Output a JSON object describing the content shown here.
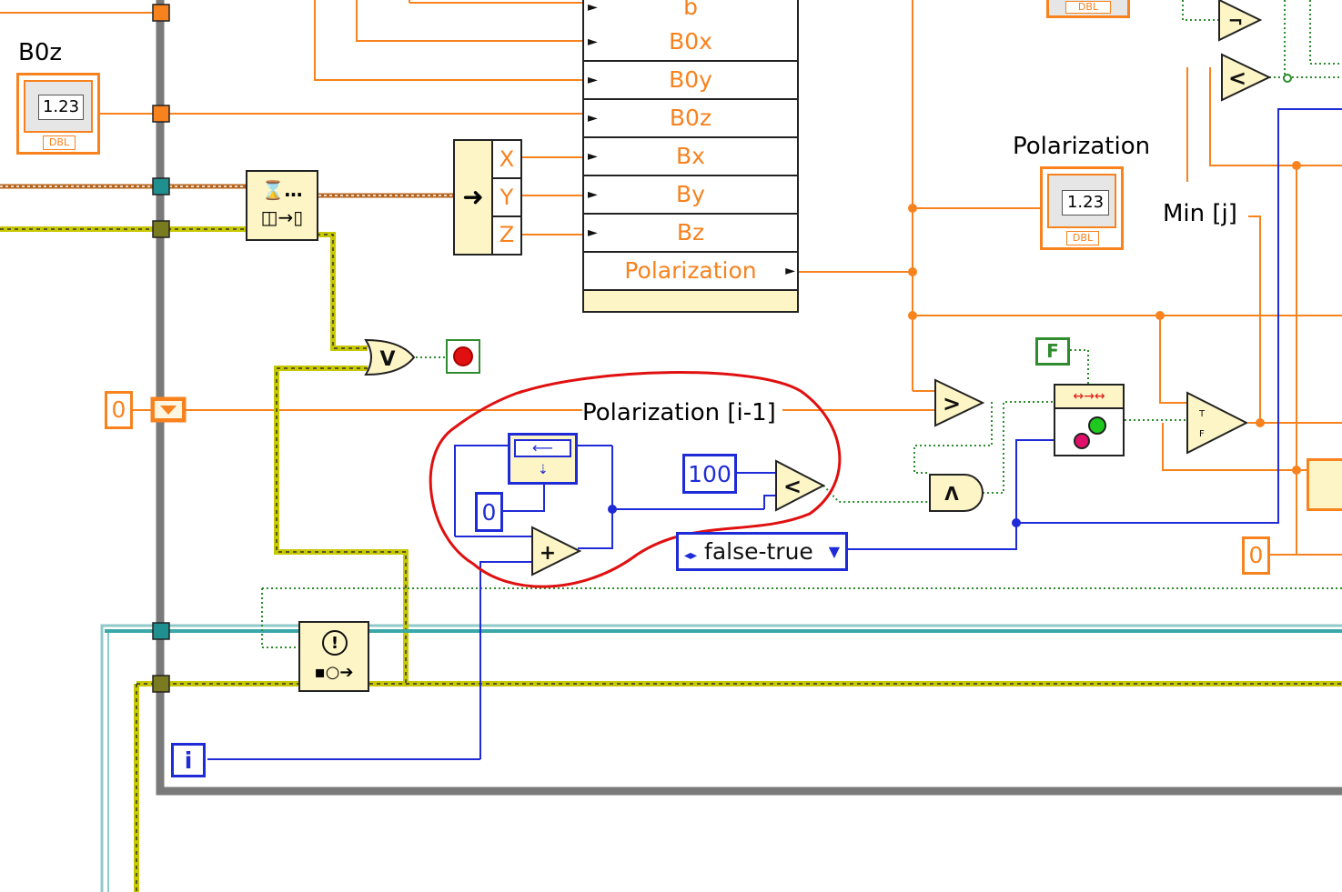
{
  "labels": {
    "b0z_label": "B0z",
    "polarization_label": "Polarization",
    "min_j_label": "Min [j]",
    "shift_register_label": "Polarization [i-1]"
  },
  "indicators": {
    "numeric_text": "1.23",
    "dbl_tag": "DBL"
  },
  "cluster": {
    "rows": [
      "b",
      "B0x",
      "B0y",
      "B0z",
      "Bx",
      "By",
      "Bz",
      "Polarization"
    ]
  },
  "unbundle": {
    "rows": [
      "X",
      "Y",
      "Z"
    ]
  },
  "constants": {
    "zero": "0",
    "hundred": "100",
    "false_const": "F",
    "iteration": "i",
    "enum_value": "false-true"
  },
  "functions": {
    "or": "V",
    "and": "Λ",
    "greater": ">",
    "less": "<",
    "add": "+",
    "not": "¬"
  },
  "colors": {
    "numeric_wire": "#f7821e",
    "integer_wire": "#1f2bd6",
    "boolean_wire": "#2e8b2e",
    "error_wire": "#c8c800",
    "loop_frame": "#808080",
    "annotation": "#e01010"
  }
}
